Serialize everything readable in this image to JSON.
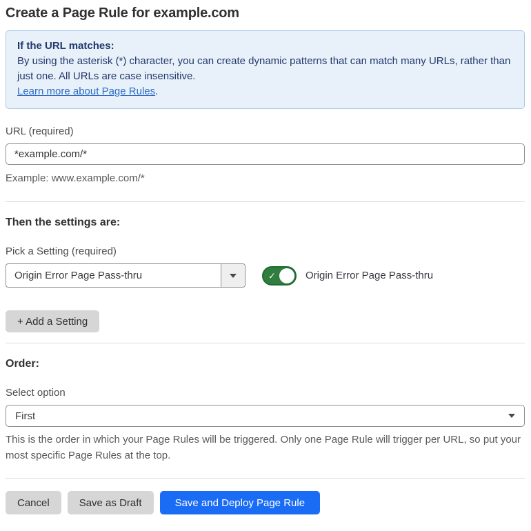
{
  "page": {
    "title": "Create a Page Rule for example.com"
  },
  "info_box": {
    "heading": "If the URL matches:",
    "body": "By using the asterisk (*) character, you can create dynamic patterns that can match many URLs, rather than just one. All URLs are case insensitive.",
    "link_label": "Learn more about Page Rules",
    "link_suffix": "."
  },
  "url_field": {
    "label": "URL (required)",
    "value": "*example.com/*",
    "helper": "Example: www.example.com/*"
  },
  "settings_section": {
    "heading": "Then the settings are:",
    "picker_label": "Pick a Setting (required)",
    "picker_value": "Origin Error Page Pass-thru",
    "toggle_state": "on",
    "toggle_check_glyph": "✓",
    "toggle_label": "Origin Error Page Pass-thru",
    "add_button_label": "+ Add a Setting"
  },
  "order_section": {
    "heading": "Order:",
    "select_label": "Select option",
    "select_value": "First",
    "helper": "This is the order in which your Page Rules will be triggered. Only one Page Rule will trigger per URL, so put your most specific Page Rules at the top."
  },
  "footer": {
    "cancel_label": "Cancel",
    "save_draft_label": "Save as Draft",
    "save_deploy_label": "Save and Deploy Page Rule"
  },
  "colors": {
    "info_bg": "#e8f1fa",
    "info_border": "#a9c9e9",
    "info_text": "#22386b",
    "link": "#2c6cc4",
    "toggle_green": "#2f7d3f",
    "primary_blue": "#1a6cf5",
    "button_gray": "#d6d6d6"
  }
}
